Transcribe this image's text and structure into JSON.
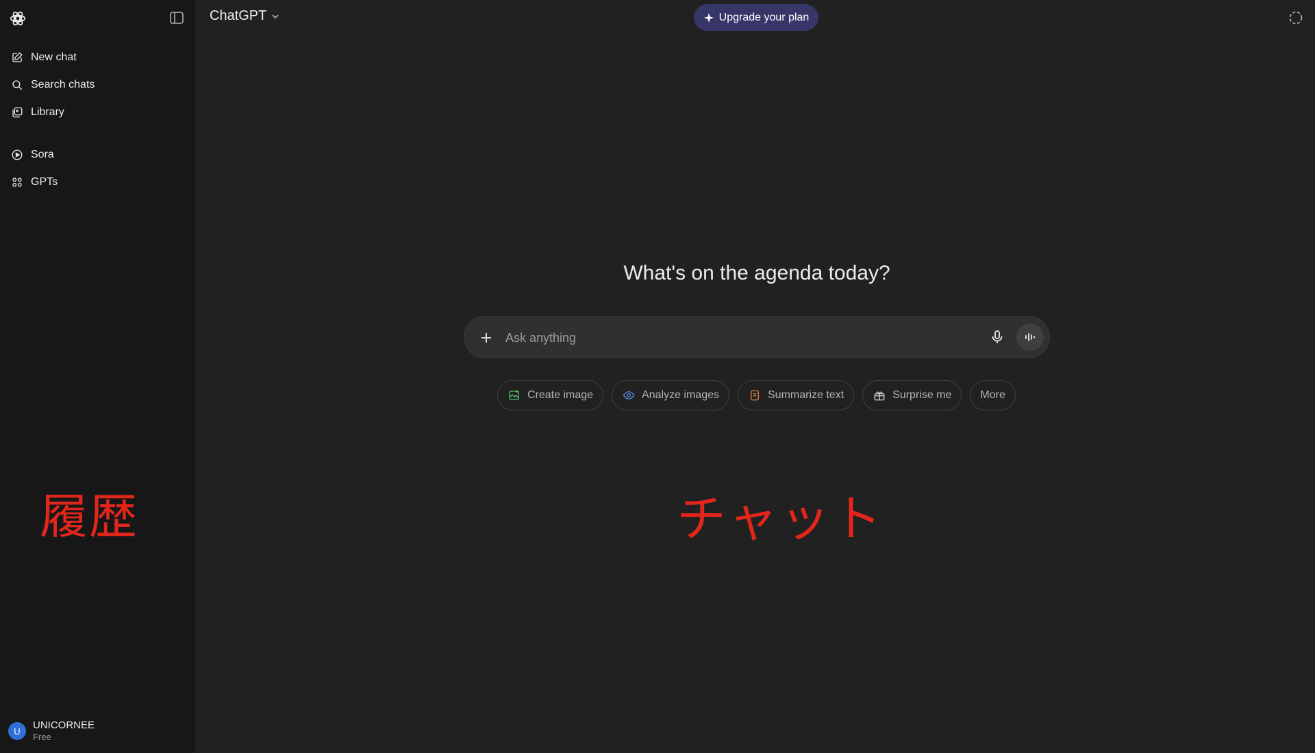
{
  "sidebar": {
    "items_top": [
      {
        "label": "New chat",
        "icon": "new-chat-icon"
      },
      {
        "label": "Search chats",
        "icon": "search-icon"
      },
      {
        "label": "Library",
        "icon": "library-icon"
      }
    ],
    "items_bottom": [
      {
        "label": "Sora",
        "icon": "sora-icon"
      },
      {
        "label": "GPTs",
        "icon": "gpts-icon"
      }
    ],
    "annotation": "履歴",
    "user": {
      "initial": "U",
      "name": "UNICORNEE",
      "plan": "Free"
    }
  },
  "header": {
    "model": "ChatGPT",
    "upgrade_label": "Upgrade your plan"
  },
  "main": {
    "headline": "What's on the agenda today?",
    "composer_placeholder": "Ask anything",
    "chips": [
      {
        "label": "Create image",
        "icon": "create-image-icon",
        "color": "#4ec16a"
      },
      {
        "label": "Analyze images",
        "icon": "analyze-images-icon",
        "color": "#5b8def"
      },
      {
        "label": "Summarize text",
        "icon": "summarize-text-icon",
        "color": "#e8834a"
      },
      {
        "label": "Surprise me",
        "icon": "surprise-me-icon",
        "color": "#cfcfcf"
      },
      {
        "label": "More",
        "icon": "",
        "color": "#b4b4b4"
      }
    ],
    "annotation": "チャット"
  },
  "colors": {
    "background": "#212121",
    "sidebar": "#171717",
    "upgrade": "#373669",
    "annotation": "#e3261b",
    "avatar": "#2f6fd6"
  }
}
